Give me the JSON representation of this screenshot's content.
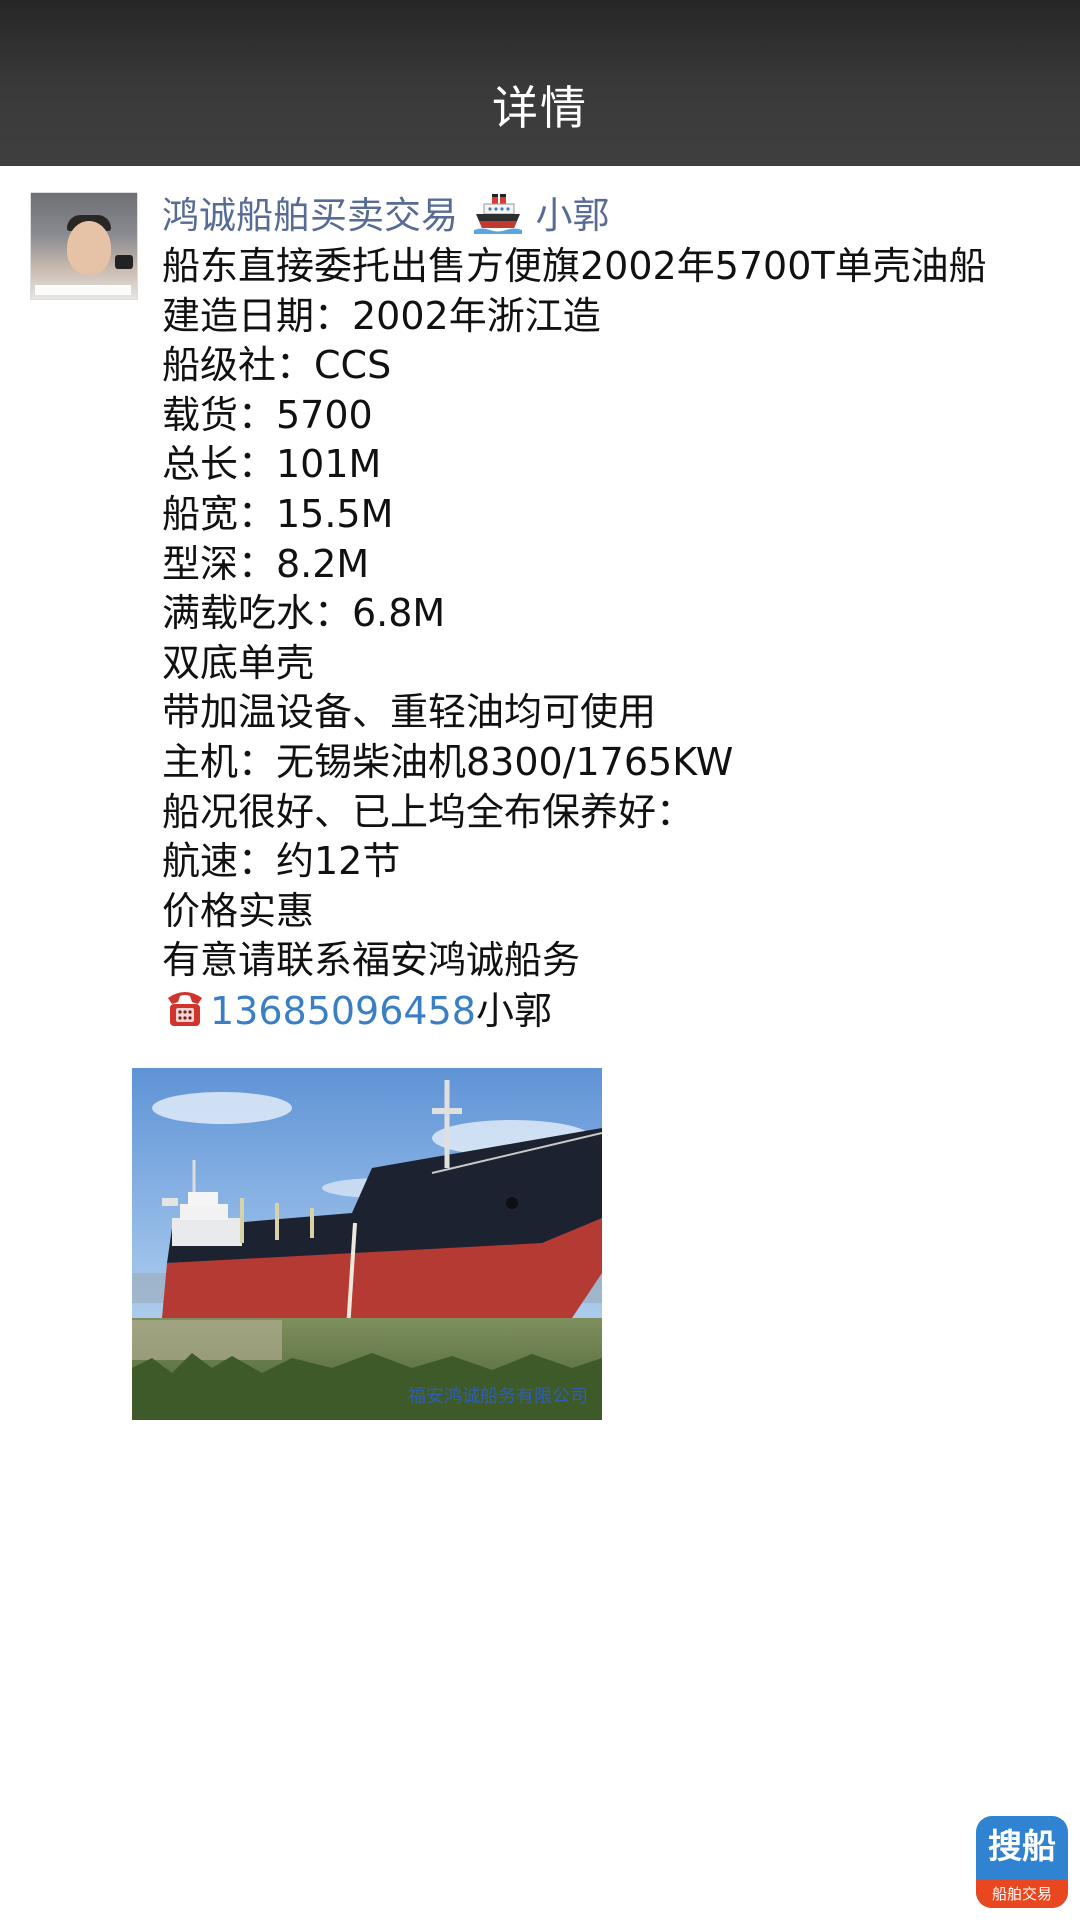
{
  "header": {
    "title": "详情"
  },
  "post": {
    "username_prefix": "鸿诚船舶买卖交易",
    "username_suffix": "小郭",
    "lines": [
      "船东直接委托出售方便旗2002年5700T单壳油船",
      "建造日期：2002年浙江造",
      "船级社：CCS",
      "载货：5700",
      "总长：101M",
      "船宽：15.5M",
      "型深：8.2M",
      "满载吃水：6.8M",
      "双底单壳",
      "带加温设备、重轻油均可使用",
      "主机：无锡柴油机8300/1765KW",
      "船况很好、已上坞全布保养好：",
      "航速：约12节",
      "价格实惠",
      "有意请联系福安鸿诚船务"
    ],
    "phone": {
      "number": "13685096458",
      "suffix": "小郭"
    },
    "photo": {
      "watermark": "福安鸿诚船务有限公司"
    }
  },
  "badge": {
    "main": "搜船",
    "sub": "船舶交易"
  },
  "colors": {
    "topbar": "#393939",
    "username": "#576b95",
    "phone_link": "#3a7fc4",
    "badge_blue": "#2f83d1",
    "badge_orange": "#e8471f"
  },
  "icons": {
    "username_emoji": "ship-icon",
    "phone_emoji": "telephone-icon"
  }
}
